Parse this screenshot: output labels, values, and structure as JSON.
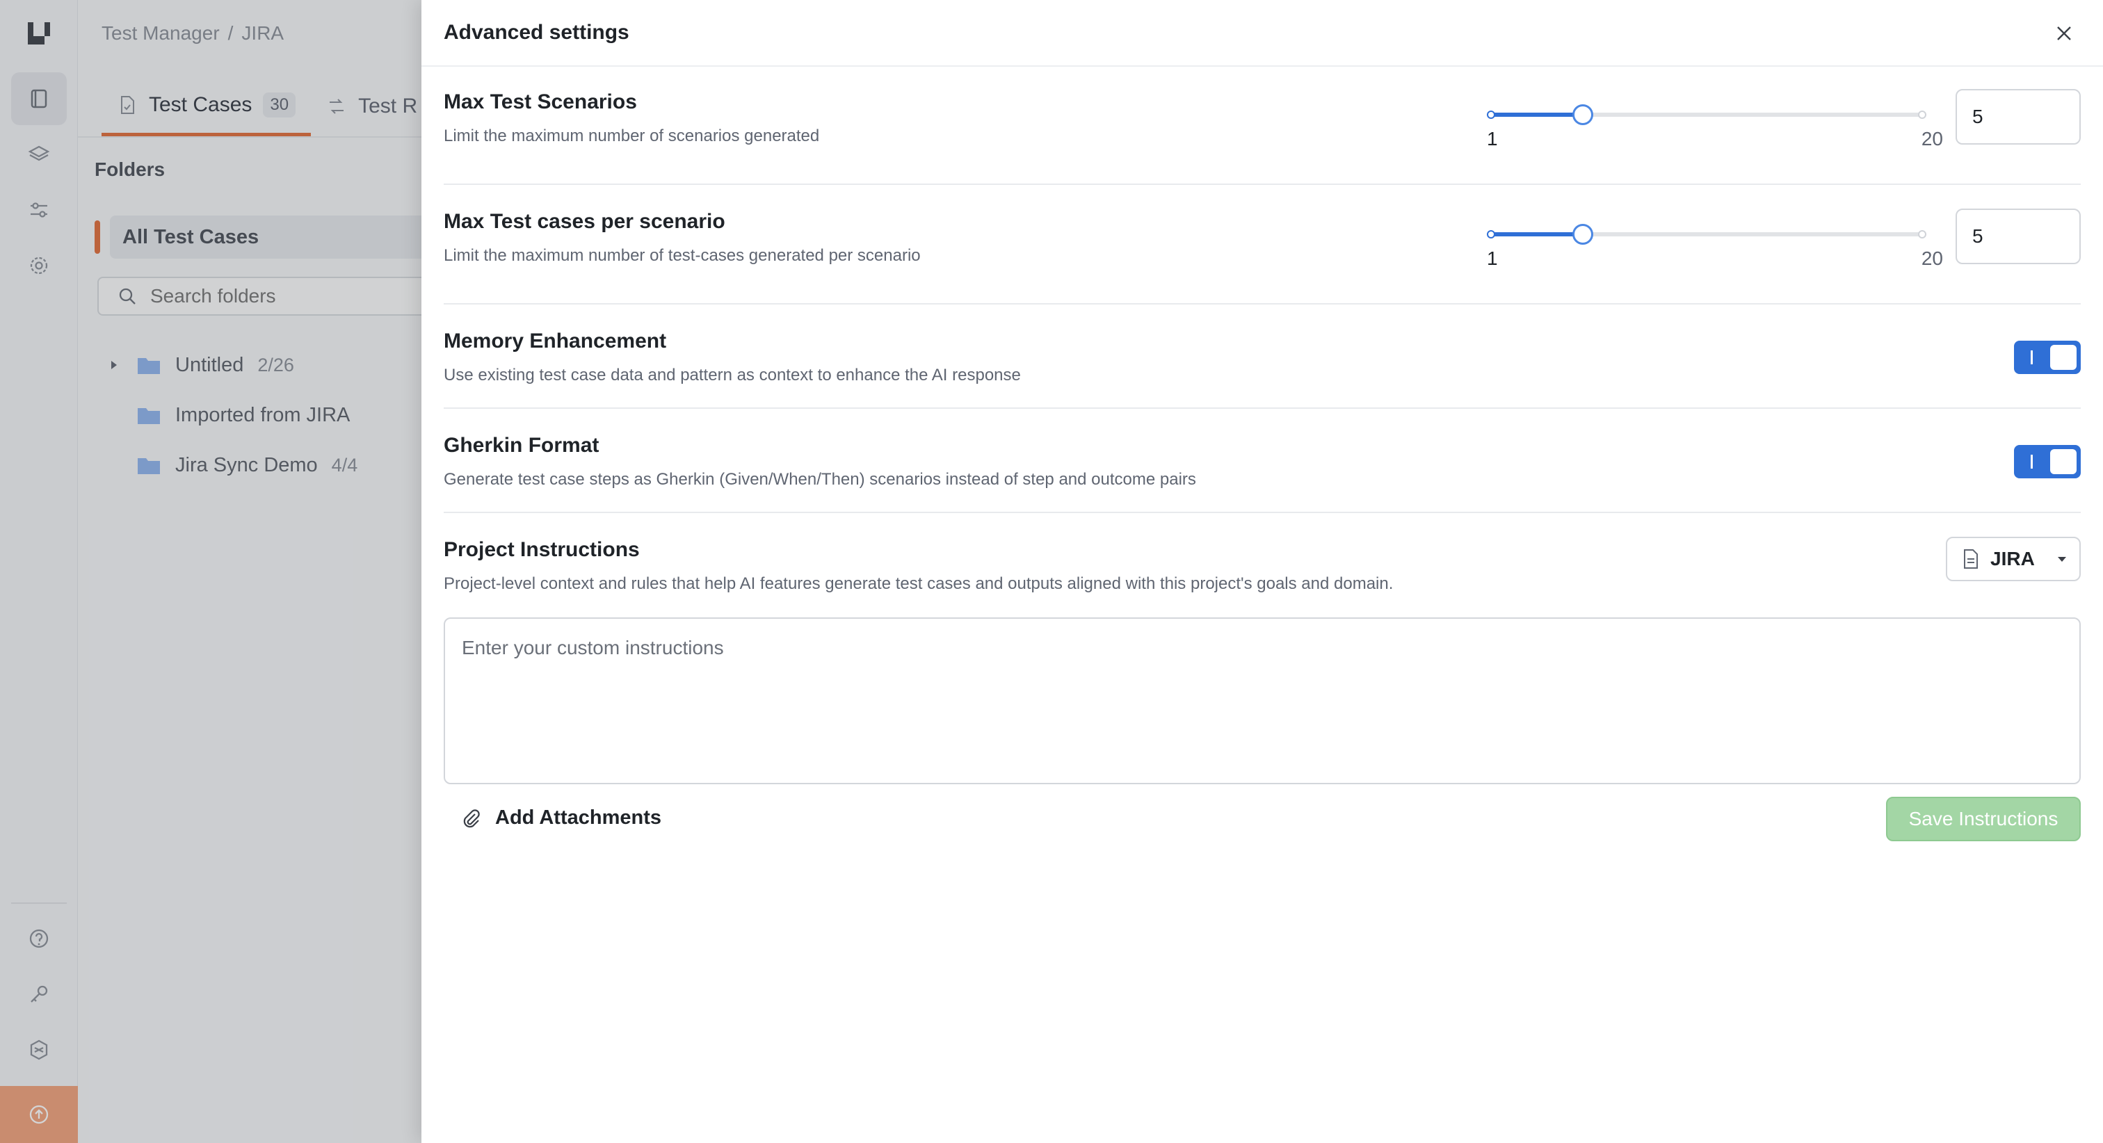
{
  "rail": {
    "logo": "app-logo",
    "items": [
      "test-cases-icon",
      "layers-icon",
      "filters-icon",
      "settings-gear-icon"
    ],
    "bottom_items": [
      "help-icon",
      "key-icon",
      "integrations-icon"
    ],
    "upgrade_icon": "upgrade-arrow-icon",
    "upgrade_color": "#f1a27c"
  },
  "page": {
    "breadcrumb": {
      "parent": "Test Manager",
      "separator": "/",
      "current": "JIRA"
    },
    "tabs": [
      {
        "label": "Test Cases",
        "count": "30"
      },
      {
        "label": "Test R"
      }
    ],
    "folders_title": "Folders",
    "all_cases": "All Test Cases",
    "search_placeholder": "Search folders",
    "folders": [
      {
        "name": "Untitled",
        "count": "2/26"
      },
      {
        "name": "Imported from JIRA",
        "count": ""
      },
      {
        "name": "Jira Sync Demo",
        "count": "4/4"
      }
    ]
  },
  "drawer": {
    "title": "Advanced settings",
    "max_scenarios": {
      "title": "Max Test Scenarios",
      "desc": "Limit the maximum number of scenarios generated",
      "min": 1,
      "max": 20,
      "value": 5,
      "min_label": "1",
      "max_label": "20",
      "input_value": "5"
    },
    "max_cases": {
      "title": "Max Test cases per scenario",
      "desc": "Limit the maximum number of test-cases generated per scenario",
      "min": 1,
      "max": 20,
      "value": 5,
      "min_label": "1",
      "max_label": "20",
      "input_value": "5"
    },
    "memory": {
      "title": "Memory Enhancement",
      "desc": "Use existing test case data and pattern as context to enhance the AI response",
      "enabled": true
    },
    "gherkin": {
      "title": "Gherkin Format",
      "desc": "Generate test case steps as Gherkin (Given/When/Then) scenarios instead of step and outcome pairs",
      "enabled": true
    },
    "instructions": {
      "title": "Project Instructions",
      "desc": "Project-level context and rules that help AI features generate test cases and outputs aligned with this project's goals and domain.",
      "project": "JIRA",
      "placeholder": "Enter your custom instructions",
      "value": "",
      "attach_label": "Add Attachments",
      "save_label": "Save Instructions"
    },
    "accent_color": "#2f6fd6",
    "save_color": "#a3d6a5"
  }
}
